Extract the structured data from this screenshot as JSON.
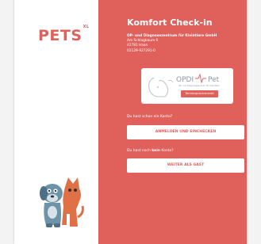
{
  "logo": {
    "text": "PETS",
    "sup": "XL"
  },
  "checkin": {
    "title": "Komfort Check-in",
    "clinic_name": "OP- und Diagnosezentrum für Kleintiere GmbH",
    "street": "Am Schlagbaum 6",
    "city": "42781 Haan",
    "phone": "02129-927291-0"
  },
  "opdi": {
    "brand_opdi": "OPDI",
    "brand_pet": "Pet",
    "subtitle": "OP- und Diagnosezentrum für Kleintiere",
    "button": "Terminsprechstunde"
  },
  "account": {
    "question": "Du hast schon ein Konto?",
    "login_button": "ANMELDEN UND EINCHECKEN"
  },
  "guest": {
    "question_prefix": "Du hast noch ",
    "question_bold": "kein",
    "question_suffix": " Konto?",
    "guest_button": "WEITER ALS GAST"
  },
  "colors": {
    "accent": "#e0605c",
    "background": "#ffffff"
  }
}
